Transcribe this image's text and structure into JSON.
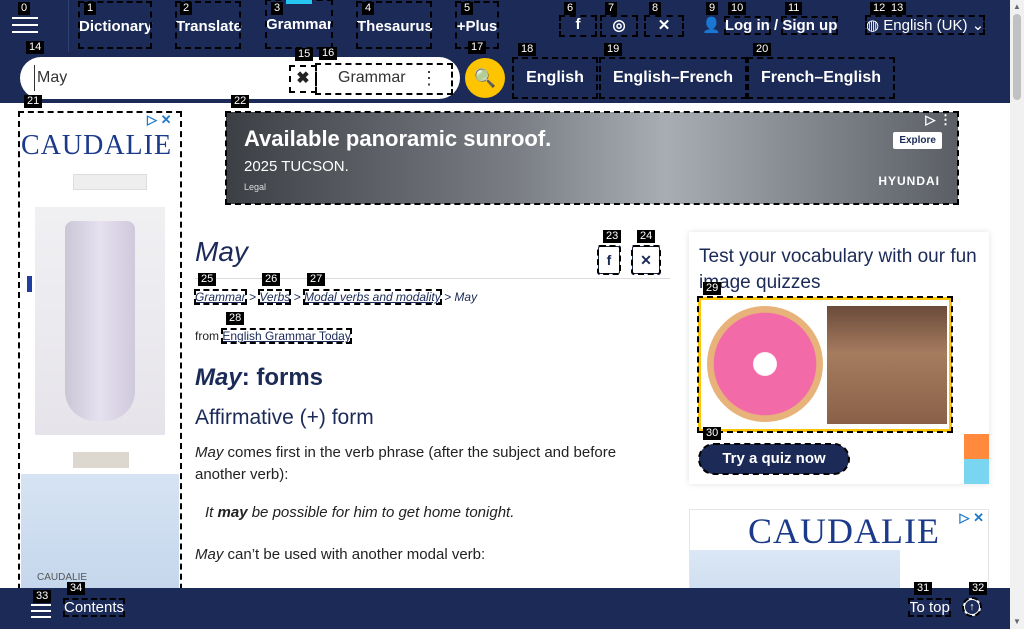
{
  "nav": {
    "links": [
      "Dictionary",
      "Translate",
      "Grammar",
      "Thesaurus",
      "+Plus"
    ],
    "login": "Log in",
    "separator": "/",
    "signup": "Sign up",
    "language": "English (UK)"
  },
  "search": {
    "value": "May",
    "dictionary": "Grammar",
    "dict_links": [
      "English",
      "English–French",
      "French–English"
    ]
  },
  "ads": {
    "left_brand": "CAUDALIE",
    "left_bottle_label": "CAUDALIE",
    "banner_headline": "Available panoramic sunroof.",
    "banner_sub": "2025 TUCSON.",
    "banner_legal": "Legal",
    "banner_cta": "Explore",
    "banner_brand": "HYUNDAI",
    "right_brand": "CAUDALIE"
  },
  "article": {
    "title": "May",
    "breadcrumb": [
      "Grammar",
      "Verbs",
      "Modal verbs and modality",
      "May"
    ],
    "breadcrumb_sep": ">",
    "from_label": "from",
    "from_link": "English Grammar Today",
    "h_forms_word": "May",
    "h_forms_rest": ": forms",
    "h_affirmative": "Affirmative (+) form",
    "p1_word": "May",
    "p1_rest": " comes first in the verb phrase (after the subject and before another verb):",
    "ex1_pre": "It ",
    "ex1_bold": "may",
    "ex1_post": " be possible for him to get home tonight.",
    "p2_word": "May",
    "p2_rest": " can’t be used with another modal verb:"
  },
  "quiz": {
    "title": "Test your vocabulary with our fun image quizzes",
    "button": "Try a quiz now"
  },
  "bottom": {
    "contents": "Contents",
    "to_top": "To top"
  },
  "tags": [
    "0",
    "1",
    "2",
    "3",
    "4",
    "5",
    "6",
    "7",
    "8",
    "9",
    "10",
    "11",
    "12",
    "13",
    "14",
    "15",
    "16",
    "17",
    "18",
    "19",
    "20",
    "21",
    "22",
    "23",
    "24",
    "25",
    "26",
    "27",
    "28",
    "29",
    "30",
    "31",
    "32",
    "33",
    "34"
  ]
}
